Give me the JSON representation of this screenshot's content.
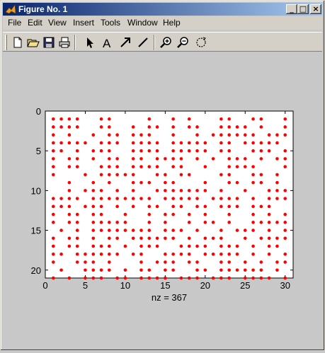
{
  "window": {
    "title": "Figure No. 1"
  },
  "title_buttons": {
    "minimize": "_",
    "maximize": "□",
    "close": "×"
  },
  "menu": [
    "File",
    "Edit",
    "View",
    "Insert",
    "Tools",
    "Window",
    "Help"
  ],
  "toolbar": {
    "groups": [
      [
        "new-file-icon",
        "open-folder-icon",
        "save-icon",
        "print-icon"
      ],
      [
        "arrow-select-icon",
        "text-icon",
        "insert-arrow-icon",
        "insert-line-icon"
      ],
      [
        "zoom-in-icon",
        "zoom-out-icon",
        "rotate-3d-icon"
      ]
    ],
    "text_tool_label": "A"
  },
  "chart_data": {
    "type": "scatter",
    "title": "",
    "xlabel": "nz = 367",
    "ylabel": "",
    "xlim": [
      0,
      31
    ],
    "ylim": [
      0,
      21
    ],
    "y_reversed": true,
    "xticks": [
      0,
      5,
      10,
      15,
      20,
      25,
      30
    ],
    "yticks": [
      0,
      5,
      10,
      15,
      20
    ],
    "marker_color": "#ff0000",
    "nz": 367,
    "rows": [
      [
        1,
        2,
        3,
        4,
        7,
        8,
        13,
        16,
        18,
        22,
        23,
        26,
        27,
        30
      ],
      [
        1,
        2,
        3,
        4,
        7,
        8,
        11,
        13,
        14,
        16,
        18,
        19,
        22,
        23,
        24,
        25,
        27,
        30
      ],
      [
        1,
        3,
        6,
        8,
        9,
        11,
        12,
        13,
        16,
        19,
        21,
        22,
        23,
        24,
        25,
        26,
        28,
        29,
        30
      ],
      [
        1,
        2,
        3,
        4,
        5,
        7,
        8,
        9,
        11,
        12,
        13,
        14,
        16,
        17,
        18,
        19,
        20,
        22,
        23,
        25,
        26,
        27,
        28,
        29
      ],
      [
        1,
        2,
        4,
        6,
        7,
        8,
        11,
        12,
        13,
        14,
        16,
        17,
        18,
        19,
        20,
        22,
        23,
        26,
        27,
        28,
        30
      ],
      [
        1,
        3,
        4,
        6,
        8,
        9,
        11,
        12,
        14,
        15,
        16,
        17,
        19,
        21,
        23,
        24,
        25,
        27,
        29,
        30
      ],
      [
        1,
        3,
        4,
        7,
        8,
        9,
        11,
        12,
        13,
        14,
        16,
        17,
        20,
        23,
        24,
        25,
        26,
        30
      ],
      [
        1,
        5,
        7,
        8,
        9,
        10,
        11,
        14,
        15,
        17,
        18,
        22,
        23,
        26,
        27,
        29
      ],
      [
        3,
        6,
        8,
        11,
        12,
        13,
        15,
        16,
        20,
        23,
        24,
        26,
        27,
        29
      ],
      [
        3,
        5,
        6,
        7,
        9,
        11,
        14,
        15,
        16,
        17,
        18,
        19,
        20,
        22,
        25,
        28,
        29,
        30
      ],
      [
        1,
        2,
        3,
        4,
        6,
        7,
        8,
        9,
        10,
        11,
        12,
        13,
        15,
        16,
        17,
        18,
        19,
        21,
        22,
        23,
        24,
        26,
        28,
        29,
        30
      ],
      [
        1,
        2,
        3,
        5,
        6,
        7,
        9,
        11,
        13,
        14,
        16,
        17,
        19,
        20,
        22,
        23,
        24,
        26,
        27,
        28
      ],
      [
        1,
        3,
        4,
        6,
        7,
        10,
        13,
        15,
        16,
        18,
        20,
        23,
        26,
        28,
        30
      ],
      [
        1,
        3,
        4,
        6,
        7,
        8,
        9,
        10,
        13,
        15,
        18,
        20,
        21,
        23,
        26,
        27,
        28,
        29,
        30
      ],
      [
        2,
        4,
        6,
        7,
        8,
        9,
        10,
        11,
        12,
        13,
        15,
        16,
        17,
        19,
        22,
        24,
        25,
        26,
        28,
        30
      ],
      [
        1,
        3,
        4,
        6,
        8,
        9,
        11,
        12,
        13,
        14,
        15,
        16,
        18,
        20,
        21,
        22,
        25,
        27,
        28,
        29,
        30
      ],
      [
        1,
        3,
        4,
        6,
        7,
        8,
        10,
        12,
        13,
        14,
        17,
        18,
        19,
        20,
        22,
        23,
        24,
        26,
        28,
        29
      ],
      [
        1,
        2,
        4,
        5,
        6,
        7,
        8,
        9,
        11,
        12,
        15,
        16,
        17,
        18,
        20,
        21,
        22,
        23,
        24,
        26,
        28,
        30
      ],
      [
        1,
        4,
        5,
        6,
        8,
        12,
        14,
        15,
        16,
        18,
        19,
        22,
        23,
        25,
        27,
        29,
        30
      ],
      [
        2,
        5,
        6,
        7,
        8,
        10,
        12,
        13,
        15,
        16,
        19,
        20,
        22,
        23,
        24,
        25,
        26,
        27,
        29
      ],
      [
        1,
        3,
        5,
        6,
        7,
        9,
        10,
        12,
        13,
        14,
        15,
        17,
        18,
        19,
        21,
        22,
        23,
        25,
        26,
        27,
        28,
        30
      ]
    ]
  }
}
